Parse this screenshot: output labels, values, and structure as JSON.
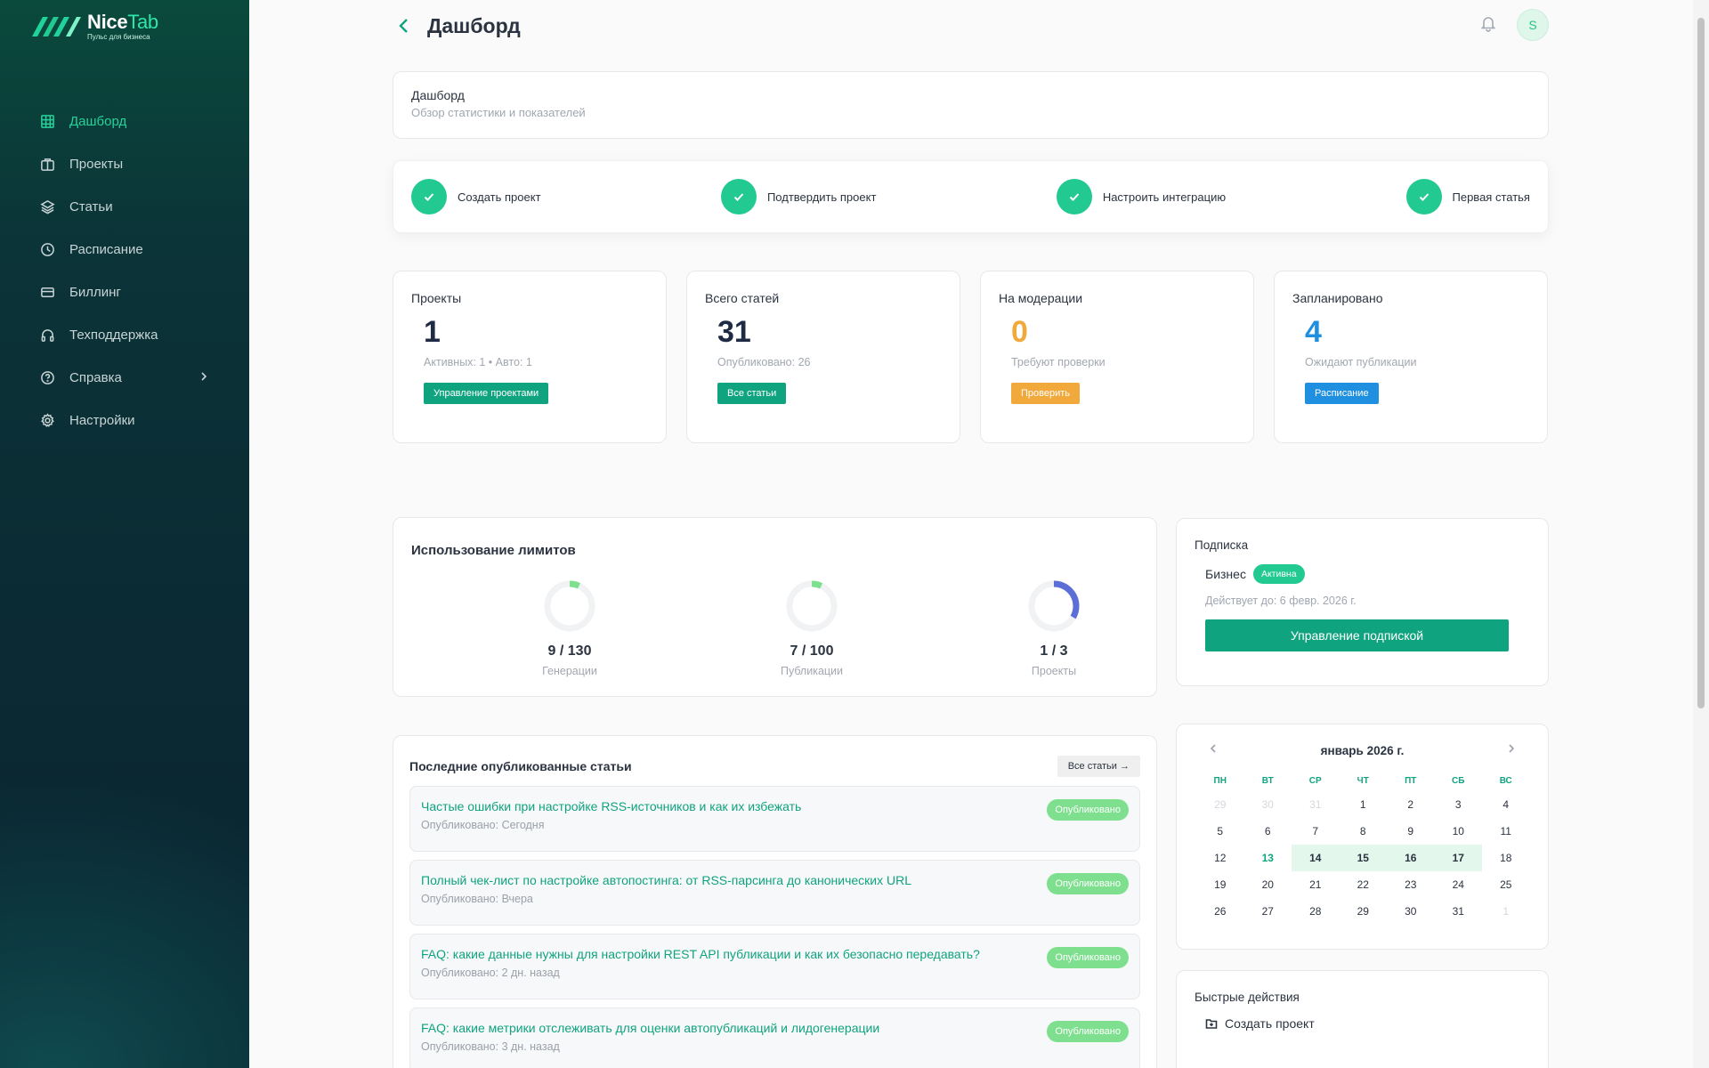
{
  "brand": {
    "name_part1": "Nice",
    "name_part2": "Tab",
    "tagline": "Пульс для бизнеса",
    "accent": "#22c990",
    "accent_dark": "#10a37f"
  },
  "sidebar": {
    "items": [
      {
        "label": "Дашборд",
        "icon": "grid-icon",
        "active": true
      },
      {
        "label": "Проекты",
        "icon": "briefcase-icon"
      },
      {
        "label": "Статьи",
        "icon": "layers-icon"
      },
      {
        "label": "Расписание",
        "icon": "clock-icon"
      },
      {
        "label": "Биллинг",
        "icon": "credit-card-icon"
      },
      {
        "label": "Техподдержка",
        "icon": "headphones-icon"
      },
      {
        "label": "Справка",
        "icon": "help-circle-icon",
        "has_submenu": true
      },
      {
        "label": "Настройки",
        "icon": "gear-icon"
      }
    ]
  },
  "header": {
    "title": "Дашборд",
    "avatar_initial": "S"
  },
  "intro": {
    "title": "Дашборд",
    "subtitle": "Обзор статистики и показателей"
  },
  "steps": [
    {
      "label": "Создать проект",
      "done": true
    },
    {
      "label": "Подтвердить проект",
      "done": true
    },
    {
      "label": "Настроить интеграцию",
      "done": true
    },
    {
      "label": "Первая статья",
      "done": true
    }
  ],
  "stats": [
    {
      "label": "Проекты",
      "value": "1",
      "sub": "Активных: 1 • Авто: 1",
      "button": "Управление проектами",
      "color": "#1f2a44",
      "button_color": "#10a37f"
    },
    {
      "label": "Всего статей",
      "value": "31",
      "sub": "Опубликовано: 26",
      "button": "Все статьи",
      "color": "#1f2a44",
      "button_color": "#10a37f"
    },
    {
      "label": "На модерации",
      "value": "0",
      "sub": "Требуют проверки",
      "button": "Проверить",
      "color": "#f2a93b",
      "button_color": "#f2a93b"
    },
    {
      "label": "Запланировано",
      "value": "4",
      "sub": "Ожидают публикации",
      "button": "Расписание",
      "color": "#1f8fe0",
      "button_color": "#1f8fe0"
    }
  ],
  "limits": {
    "title": "Использование лимитов",
    "items": [
      {
        "used": 9,
        "total": 130,
        "value_text": "9 / 130",
        "label": "Генерации",
        "color": "#7ee08f"
      },
      {
        "used": 7,
        "total": 100,
        "value_text": "7 / 100",
        "label": "Публикации",
        "color": "#7ee08f"
      },
      {
        "used": 1,
        "total": 3,
        "value_text": "1 / 3",
        "label": "Проекты",
        "color": "#5b6fd6"
      }
    ]
  },
  "subscription": {
    "title": "Подписка",
    "plan": "Бизнес",
    "status": "Активна",
    "valid_until": "Действует до: 6 февр. 2026 г.",
    "button": "Управление подпиской"
  },
  "articles": {
    "title": "Последние опубликованные статьи",
    "all_button": "Все статьи →",
    "items": [
      {
        "title": "Частые ошибки при настройке RSS-источников и как их избежать",
        "date": "Опубликовано: Сегодня",
        "status": "Опубликовано"
      },
      {
        "title": "Полный чек-лист по настройке автопостинга: от RSS-парсинга до канонических URL",
        "date": "Опубликовано: Вчера",
        "status": "Опубликовано"
      },
      {
        "title": "FAQ: какие данные нужны для настройки REST API публикации и как их безопасно передавать?",
        "date": "Опубликовано: 2 дн. назад",
        "status": "Опубликовано"
      },
      {
        "title": "FAQ: какие метрики отслеживать для оценки автопубликаций и лидогенерации",
        "date": "Опубликовано: 3 дн. назад",
        "status": "Опубликовано"
      }
    ]
  },
  "calendar": {
    "title": "январь 2026 г.",
    "weekdays": [
      "ПН",
      "ВТ",
      "СР",
      "ЧТ",
      "ПТ",
      "СБ",
      "ВС"
    ],
    "days": [
      {
        "d": "29",
        "m": true
      },
      {
        "d": "30",
        "m": true
      },
      {
        "d": "31",
        "m": true
      },
      {
        "d": "1"
      },
      {
        "d": "2"
      },
      {
        "d": "3"
      },
      {
        "d": "4"
      },
      {
        "d": "5"
      },
      {
        "d": "6"
      },
      {
        "d": "7"
      },
      {
        "d": "8"
      },
      {
        "d": "9"
      },
      {
        "d": "10"
      },
      {
        "d": "11"
      },
      {
        "d": "12"
      },
      {
        "d": "13",
        "today": true
      },
      {
        "d": "14",
        "hl": true
      },
      {
        "d": "15",
        "hl": true
      },
      {
        "d": "16",
        "hl": true
      },
      {
        "d": "17",
        "hl": true
      },
      {
        "d": "18"
      },
      {
        "d": "19"
      },
      {
        "d": "20"
      },
      {
        "d": "21"
      },
      {
        "d": "22"
      },
      {
        "d": "23"
      },
      {
        "d": "24"
      },
      {
        "d": "25"
      },
      {
        "d": "26"
      },
      {
        "d": "27"
      },
      {
        "d": "28"
      },
      {
        "d": "29"
      },
      {
        "d": "30"
      },
      {
        "d": "31"
      },
      {
        "d": "1",
        "m": true
      }
    ]
  },
  "quick_actions": {
    "title": "Быстрые действия",
    "items": [
      {
        "label": "Создать проект",
        "icon": "folder-plus-icon"
      }
    ]
  }
}
